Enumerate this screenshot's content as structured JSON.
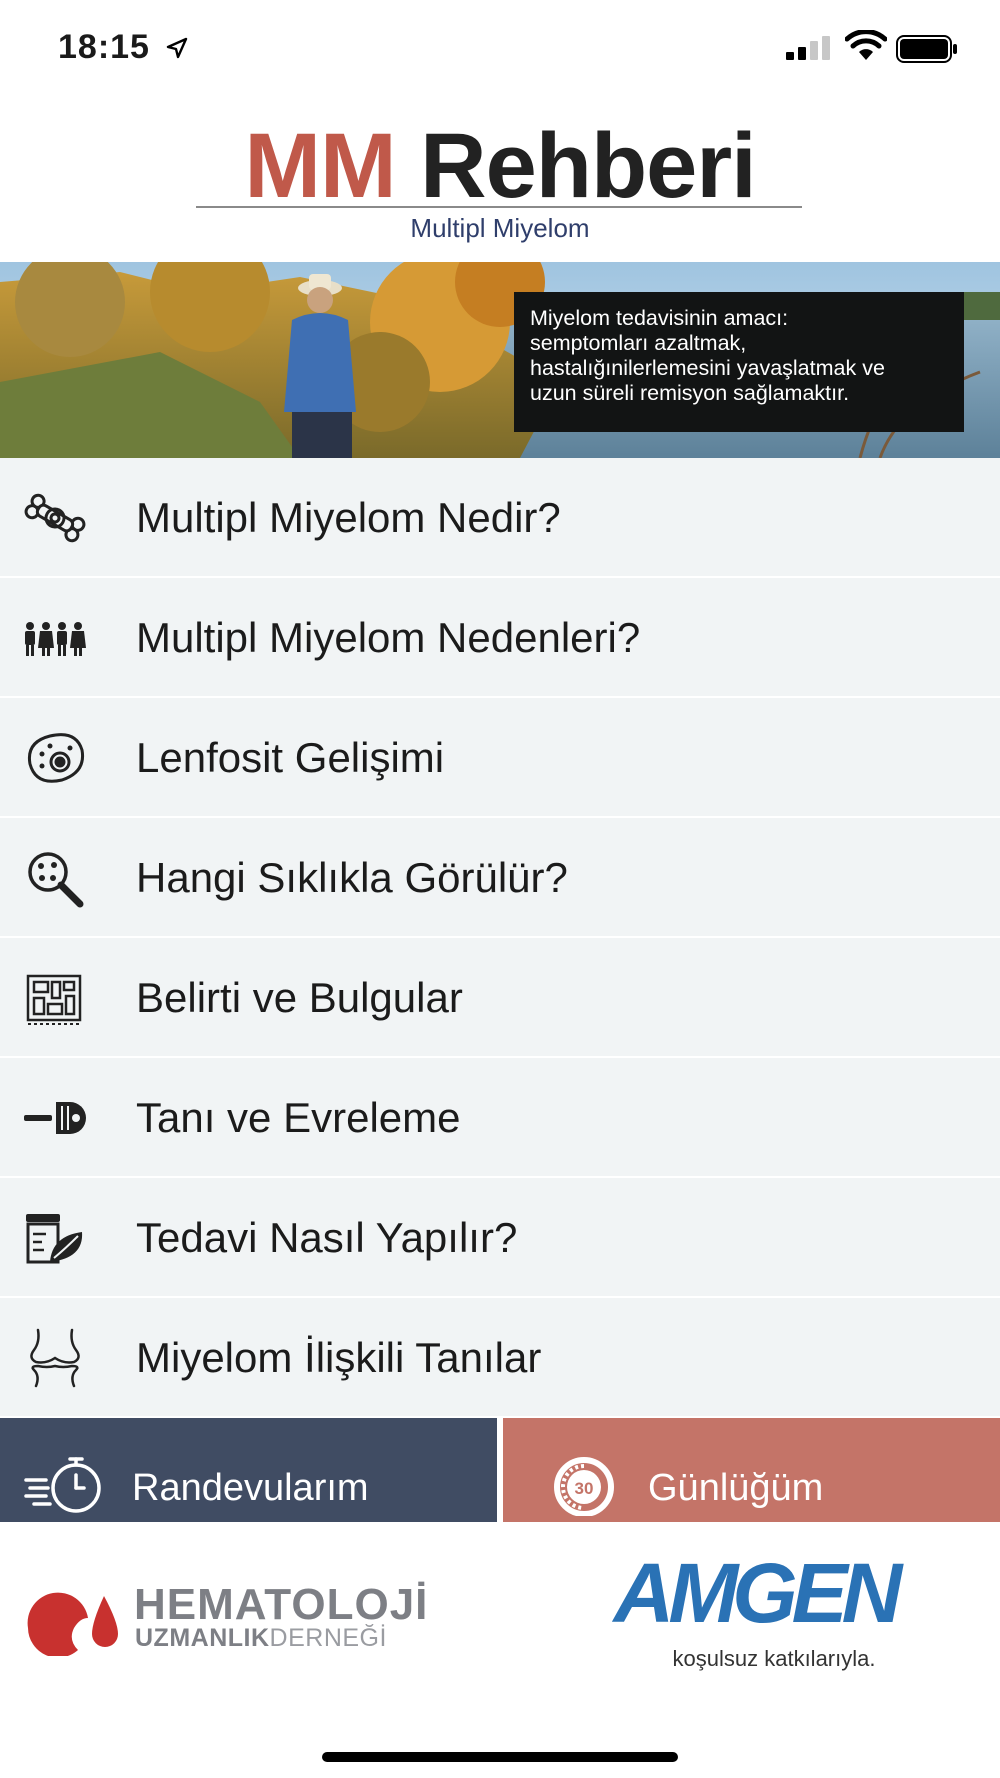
{
  "status_bar": {
    "time": "18:15"
  },
  "header": {
    "title_part1": "MM",
    "title_part2": "Rehberi",
    "subtitle": "Multipl Miyelom"
  },
  "banner": {
    "caption": "Miyelom tedavisinin amacı:\nsemptomları azaltmak,\nhastalığınilerlemesini yavaşlatmak ve\nuzun süreli remisyon sağlamaktır."
  },
  "menu": {
    "items": [
      {
        "label": "Multipl Miyelom Nedir?",
        "icon": "bone-icon"
      },
      {
        "label": "Multipl Miyelom Nedenleri?",
        "icon": "people-icon"
      },
      {
        "label": "Lenfosit Gelişimi",
        "icon": "cell-icon"
      },
      {
        "label": "Hangi Sıklıkla Görülür?",
        "icon": "magnifier-icon"
      },
      {
        "label": "Belirti ve Bulgular",
        "icon": "chart-board-icon"
      },
      {
        "label": "Tanı ve Evreleme",
        "icon": "scanner-icon"
      },
      {
        "label": "Tedavi Nasıl Yapılır?",
        "icon": "medicine-leaf-icon"
      },
      {
        "label": "Miyelom İlişkili Tanılar",
        "icon": "knee-joint-icon"
      }
    ]
  },
  "buttons": {
    "appointments_label": "Randevularım",
    "diary_label": "Günlüğüm",
    "diary_icon_text": "30"
  },
  "sponsors": {
    "hematoloji_line1": "HEMATOLOJİ",
    "hematoloji_line2_a": "UZMANLIK",
    "hematoloji_line2_b": "DERNEĞİ",
    "amgen_name": "AMGEN",
    "amgen_tagline": "koşulsuz katkılarıyla."
  },
  "colors": {
    "accent_red": "#c0594a",
    "navy_button": "#404c63",
    "salmon_button": "#c47468",
    "menu_bg": "#f1f4f5",
    "amgen_blue": "#2a72b5"
  }
}
